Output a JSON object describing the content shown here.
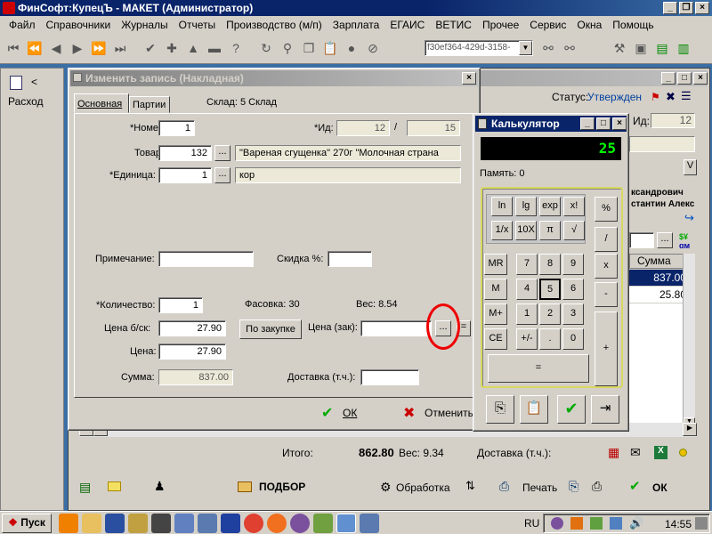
{
  "app": {
    "title": "ФинСофт:КупецЪ - МАКЕТ  (Администратор)",
    "menu": [
      "Файл",
      "Справочники",
      "Журналы",
      "Отчеты",
      "Производство (м/п)",
      "Зарплата",
      "ЕГАИС",
      "ВЕТИС",
      "Прочее",
      "Сервис",
      "Окна",
      "Помощь"
    ],
    "toolbar_combo": "f30ef364-429d-3158-"
  },
  "left_panel": {
    "label": "Расход"
  },
  "back_window": {
    "status_label": "Статус:",
    "status_value": "Утвержден",
    "id_label": "Ид:",
    "id_value": "12",
    "person1": "ксандрович",
    "person2": "стантин Алекс",
    "col_sum": "Сумма",
    "rows": [
      "837.00",
      "25.80"
    ],
    "total_label": "Итого:",
    "total_value": "862.80",
    "weight_label": "Вес: 9.34",
    "delivery_label": "Доставка (т.ч.):",
    "podbor": "ПОДБОР",
    "obrabotka": "Обработка",
    "pechat": "Печать",
    "ok": "ОК"
  },
  "edit_dialog": {
    "title": "Изменить запись (Накладная)",
    "tabs": [
      "Основная",
      "Партии"
    ],
    "sklad": "Склад: 5 Склад",
    "nomer_label": "*Номер:",
    "nomer_value": "1",
    "id_label": "*Ид:",
    "id_value": "12",
    "id_sep": "/",
    "id_value2": "15",
    "tovar_label": "Товар:",
    "tovar_code": "132",
    "tovar_name": "\"Вареная сгущенка\" 270г \"Молочная страна",
    "edinica_label": "*Единица:",
    "edinica_value": "1",
    "edinica_name": "кор",
    "primechanie_label": "Примечание:",
    "primechanie_value": "",
    "skidka_label": "Скидка %:",
    "skidka_value": "",
    "kolichestvo_label": "*Количество:",
    "kolichestvo_value": "1",
    "fasovka": "Фасовка:  30",
    "ves": "Вес:  8.54",
    "cena_bsk_label": "Цена б/ск:",
    "cena_bsk_value": "27.90",
    "po_zakupke": "По закупке",
    "cena_zak_label": "Цена (зак):",
    "cena_zak_value": "",
    "cena_label": "Цена:",
    "cena_value": "27.90",
    "summa_label": "Сумма:",
    "summa_value": "837.00",
    "dostavka_label": "Доставка (т.ч.):",
    "dostavka_value": "",
    "ok_label": "ОК",
    "cancel_label": "Отменить",
    "ellipsis": "...",
    "equals": "="
  },
  "calculator": {
    "title": "Калькулятор",
    "display": "25",
    "memory": "Память: 0",
    "fn_row1": [
      "ln",
      "lg",
      "exp",
      "x!"
    ],
    "fn_row2": [
      "1/x",
      "10X",
      "π",
      "√"
    ],
    "mem": [
      "MR",
      "M",
      "M+",
      "CE"
    ],
    "digits": [
      [
        "7",
        "8",
        "9"
      ],
      [
        "4",
        "5",
        "6"
      ],
      [
        "1",
        "2",
        "3"
      ],
      [
        "+/-",
        ".",
        "0"
      ]
    ],
    "ops": [
      "%",
      "/",
      "x",
      "-",
      "+"
    ],
    "equals": "="
  },
  "taskbar": {
    "start": "Пуск",
    "lang": "RU",
    "clock": "14:55"
  },
  "colors": {
    "titlebar": "#0a246a",
    "desktop": "#3a6ea5",
    "selected_row": "#0a246a",
    "display_text": "#00ff00"
  }
}
